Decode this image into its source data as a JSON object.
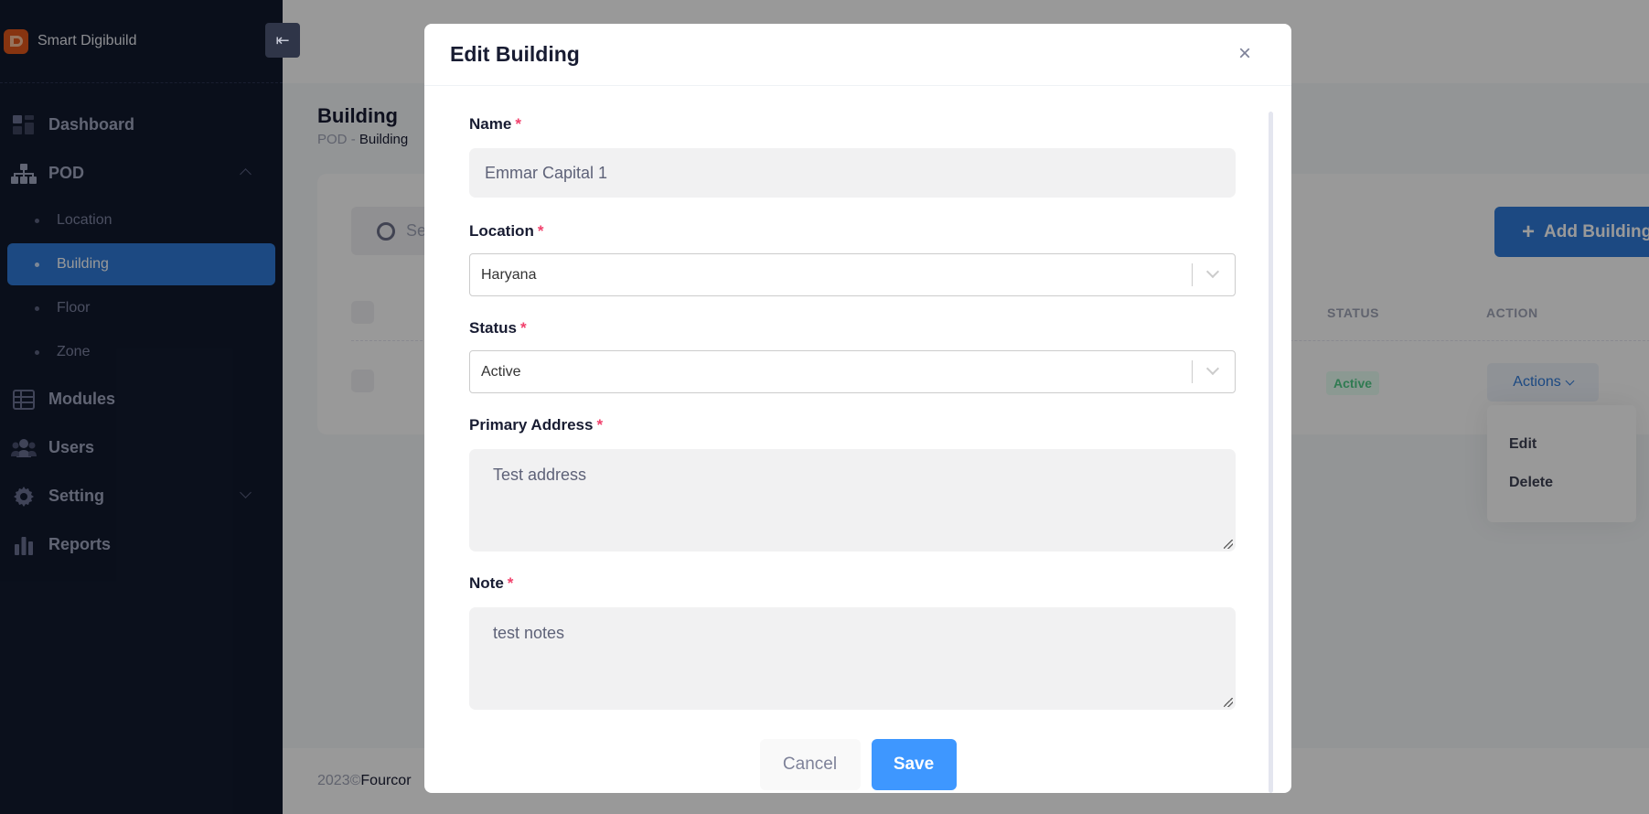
{
  "app": {
    "name": "Smart Digibuild"
  },
  "sidebar": {
    "items": [
      {
        "label": "Dashboard",
        "icon": "dashboard-icon"
      },
      {
        "label": "POD",
        "icon": "sitemap-icon",
        "expanded": true,
        "children": [
          {
            "label": "Location"
          },
          {
            "label": "Building",
            "active": true
          },
          {
            "label": "Floor"
          },
          {
            "label": "Zone"
          }
        ]
      },
      {
        "label": "Modules",
        "icon": "grid-icon"
      },
      {
        "label": "Users",
        "icon": "users-icon"
      },
      {
        "label": "Setting",
        "icon": "gear-icon"
      },
      {
        "label": "Reports",
        "icon": "bar-chart-icon"
      }
    ]
  },
  "page": {
    "title": "Building",
    "breadcrumb": [
      "POD",
      "-",
      "Building"
    ],
    "search_placeholder": "Se",
    "add_button": "Add Building",
    "columns": {
      "status": "STATUS",
      "action": "ACTION"
    },
    "row": {
      "status": "Active",
      "actions_label": "Actions"
    },
    "action_menu": [
      "Edit",
      "Delete"
    ],
    "footer": {
      "year": "2023©",
      "company": "Fourcor"
    }
  },
  "modal": {
    "title": "Edit Building",
    "fields": {
      "name": {
        "label": "Name",
        "value": "Emmar Capital 1"
      },
      "location": {
        "label": "Location",
        "value": "Haryana"
      },
      "status": {
        "label": "Status",
        "value": "Active"
      },
      "primary_address": {
        "label": "Primary Address",
        "value": "Test address"
      },
      "note": {
        "label": "Note",
        "value": "test notes"
      }
    },
    "required_mark": "*",
    "cancel": "Cancel",
    "save": "Save"
  },
  "colors": {
    "sidebar_bg": "#121a2e",
    "accent": "#2f7ad9",
    "save": "#3e97ff",
    "required": "#f1416c"
  }
}
